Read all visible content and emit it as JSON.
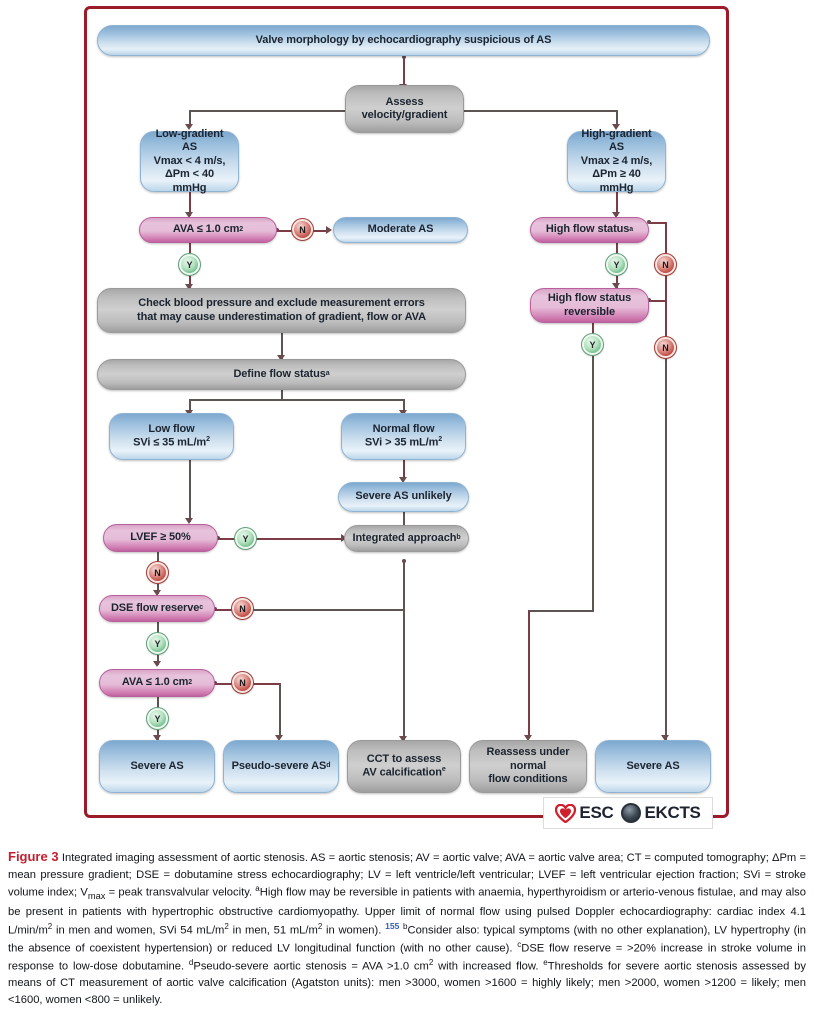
{
  "figure": {
    "label": "Figure 3",
    "caption_part1": "Integrated imaging assessment of aortic stenosis. AS = aortic stenosis; AV = aortic valve; AVA = aortic valve area; CT = computed tomography; ΔPm = mean pressure gradient; DSE = dobutamine stress echocardiography; LV = left ventricle/left ventricular; LVEF = left ventricular ejection fraction; SVi = stroke volume index; V",
    "vmax_sub": "max",
    "caption_part2": " = peak transvalvular velocity. ",
    "note_a_marker": "a",
    "note_a": "High flow may be reversible in patients with anaemia, hyperthyroidism or arterio-venous fistulae, and may also be present in patients with hypertrophic obstructive cardiomyopathy. Upper limit of normal flow using pulsed Doppler echocardiography: cardiac index 4.1 L/min/m",
    "sup2a": "2",
    "note_a2": " in men and women, SVi 54 mL/m",
    "sup2b": "2",
    "note_a3": " in men, 51 mL/m",
    "sup2c": "2",
    "note_a4": " in women). ",
    "reference": "155",
    "note_b_marker": "b",
    "note_b": "Consider also: typical symptoms (with no other explanation), LV hypertrophy (in the absence of coexistent hypertension) or reduced LV longitudinal function (with no other cause). ",
    "note_c_marker": "c",
    "note_c": "DSE flow reserve = >20% increase in stroke volume in response to low-dose dobutamine. ",
    "note_d_marker": "d",
    "note_d": "Pseudo-severe aortic stenosis = AVA >1.0 cm",
    "sup2d": "2",
    "note_d2": " with increased flow. ",
    "note_e_marker": "e",
    "note_e": "Thresholds for severe aortic stenosis assessed by means of CT measurement of aortic valve calcification (Agatston units): men >3000, women >1600 = highly likely; men >2000, women >1200 = likely; men <1600, women <800 = unlikely."
  },
  "colors": {
    "frame_border": "#9b1c28",
    "blue_node": "#9dc0de",
    "grey_node": "#bdbdbd",
    "pink_node": "#d9a4c8",
    "yes_badge": "#72bd8b",
    "no_badge": "#bf4b43",
    "connector": "#5d5553",
    "figure_label": "#c21f2f",
    "reference_link": "#2f5fb5"
  },
  "nodes": {
    "title": {
      "text": "Valve morphology by echocardiography suspicious of AS",
      "style": "blue"
    },
    "assess": {
      "line1": "Assess",
      "line2": "velocity/gradient",
      "style": "grey"
    },
    "low_gradient": {
      "line1": "Low-gradient AS",
      "line2": "Vmax < 4 m/s,",
      "line3": "ΔPm < 40 mmHg",
      "style": "blue"
    },
    "high_gradient": {
      "line1": "High-gradient AS",
      "line2": "Vmax ≥ 4 m/s,",
      "line3": "ΔPm ≥ 40 mmHg",
      "style": "blue"
    },
    "ava_1": {
      "text": "AVA ≤ 1.0 cm",
      "sup": "2",
      "style": "pink"
    },
    "moderate_as": {
      "text": "Moderate AS",
      "style": "blue"
    },
    "high_flow_status": {
      "text": "High flow status",
      "sup": "a",
      "style": "pink"
    },
    "high_flow_reversible": {
      "line1": "High flow status",
      "line2": "reversible",
      "style": "pink"
    },
    "check_bp": {
      "line1": "Check blood pressure and exclude measurement errors",
      "line2": "that may cause underestimation of gradient, flow or AVA",
      "style": "grey"
    },
    "define_flow": {
      "text": "Define flow status",
      "sup": "a",
      "style": "grey"
    },
    "low_flow": {
      "line1": "Low flow",
      "line2": "SVi ≤ 35 mL/m",
      "sup": "2",
      "style": "blue"
    },
    "normal_flow": {
      "line1": "Normal flow",
      "line2": "SVi > 35 mL/m",
      "sup": "2",
      "style": "blue"
    },
    "severe_unlikely": {
      "text": "Severe AS unlikely",
      "style": "blue"
    },
    "lvef": {
      "text": "LVEF ≥ 50%",
      "style": "pink"
    },
    "integrated": {
      "text": "Integrated approach",
      "sup": "b",
      "style": "grey"
    },
    "dse": {
      "text": "DSE flow reserve",
      "sup": "c",
      "style": "pink"
    },
    "ava_2": {
      "text": "AVA ≤ 1.0 cm",
      "sup": "2",
      "style": "pink"
    },
    "severe_as_left": {
      "text": "Severe AS",
      "style": "blue"
    },
    "pseudo_severe": {
      "text": "Pseudo-severe AS",
      "sup": "d",
      "style": "blue"
    },
    "cct": {
      "line1": "CCT to assess",
      "line2": "AV calcification",
      "sup": "e",
      "style": "grey"
    },
    "reassess": {
      "line1": "Reassess under",
      "line2": "normal",
      "line3": "flow conditions",
      "style": "grey"
    },
    "severe_as_right": {
      "text": "Severe AS",
      "style": "blue"
    }
  },
  "badges": {
    "n_ava1": "N",
    "y_ava1": "Y",
    "y_highflow": "Y",
    "n_highflow": "N",
    "y_reversible": "Y",
    "n_reversible": "N",
    "y_lvef": "Y",
    "n_lvef": "N",
    "n_dse": "N",
    "y_dse": "Y",
    "n_ava2": "N",
    "y_ava2": "Y"
  },
  "logos": {
    "esc_label": "ESC",
    "esc_icon": "heart-icon",
    "eacts_label": "EΚCTS",
    "eacts_icon": "globe-emblem-icon"
  }
}
